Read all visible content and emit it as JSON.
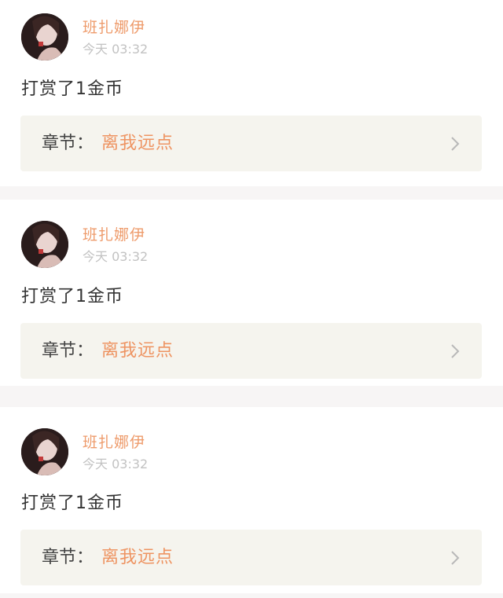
{
  "items": [
    {
      "username": "班扎娜伊",
      "time": "今天 03:32",
      "message": "打赏了1金币",
      "chapter_label": "章节：",
      "chapter_title": "离我远点"
    },
    {
      "username": "班扎娜伊",
      "time": "今天 03:32",
      "message": "打赏了1金币",
      "chapter_label": "章节：",
      "chapter_title": "离我远点"
    },
    {
      "username": "班扎娜伊",
      "time": "今天 03:32",
      "message": "打赏了1金币",
      "chapter_label": "章节：",
      "chapter_title": "离我远点"
    }
  ],
  "icons": {
    "avatar": "user-avatar",
    "chevron": "chevron-right-icon"
  },
  "colors": {
    "username": "#ee9b6b",
    "chapter_title": "#ee9462",
    "timestamp": "#c2c2c2",
    "chapter_box_bg": "#f5f4ee",
    "page_bg": "#f7f5f5"
  }
}
